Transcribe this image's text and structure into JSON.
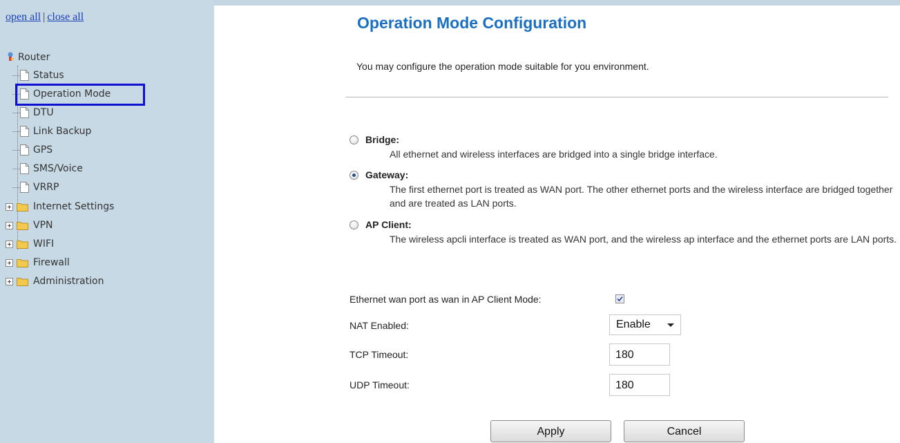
{
  "sidebar": {
    "open_all": "open all",
    "separator": "|",
    "close_all": "close all",
    "tree": {
      "root": "Router",
      "items": [
        "Status",
        "Operation Mode",
        "DTU",
        "Link Backup",
        "GPS",
        "SMS/Voice",
        "VRRP"
      ],
      "folders": [
        "Internet Settings",
        "VPN",
        "WIFI",
        "Firewall",
        "Administration"
      ]
    },
    "selected_item": "Operation Mode"
  },
  "page": {
    "title": "Operation Mode Configuration",
    "description": "You may configure the operation mode suitable for you environment.",
    "modes": [
      {
        "label": "Bridge:",
        "description": "All ethernet and wireless interfaces are bridged into a single bridge interface.",
        "checked": false
      },
      {
        "label": "Gateway:",
        "description": "The first ethernet port is treated as WAN port. The other ethernet ports and the wireless interface are bridged together and are treated as LAN ports.",
        "checked": true
      },
      {
        "label": "AP Client:",
        "description": "The wireless apcli interface is treated as WAN port, and the wireless ap interface and the ethernet ports are LAN ports.",
        "checked": false
      }
    ],
    "ethernet_wan_label": "Ethernet wan port as wan in AP Client Mode:",
    "ethernet_wan_checked": true,
    "nat_label": "NAT Enabled:",
    "nat_value": "Enable",
    "tcp_label": "TCP Timeout:",
    "tcp_value": "180",
    "udp_label": "UDP Timeout:",
    "udp_value": "180",
    "apply_label": "Apply",
    "cancel_label": "Cancel"
  },
  "colors": {
    "sidebar_bg": "#c8d9e6",
    "title": "#1a6fc0",
    "link": "#1a3fb5",
    "highlight_box": "#1010d0",
    "folder": "#f2c94c"
  }
}
